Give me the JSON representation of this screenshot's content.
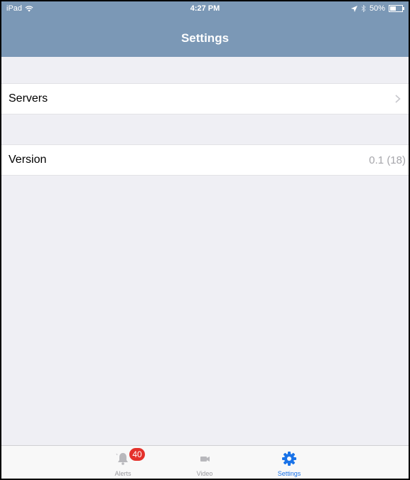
{
  "status_bar": {
    "device": "iPad",
    "time": "4:27 PM",
    "battery": "50%",
    "battery_level": 0.5
  },
  "nav": {
    "title": "Settings"
  },
  "rows": {
    "servers": {
      "label": "Servers"
    },
    "version": {
      "label": "Version",
      "value": "0.1 (18)"
    }
  },
  "tabs": {
    "alerts": {
      "label": "Alerts",
      "badge": "40",
      "icon": "bell-icon"
    },
    "video": {
      "label": "Video",
      "icon": "video-camera-icon"
    },
    "settings": {
      "label": "Settings",
      "icon": "gear-icon",
      "selected": true
    }
  },
  "colors": {
    "nav_background": "#7b98b6",
    "accent": "#1a73e8",
    "badge": "#e4312b"
  }
}
